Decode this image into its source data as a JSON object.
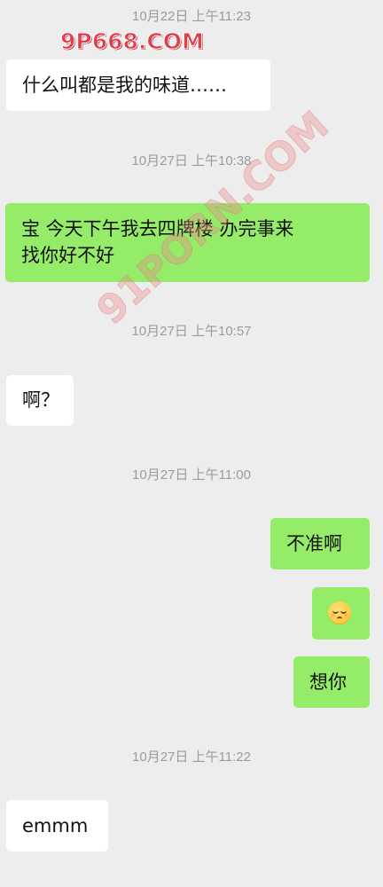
{
  "messages": [
    {
      "timestamp": "10月22日 上午11:23",
      "direction": "in",
      "text": "什么叫都是我的味道……"
    },
    {
      "timestamp": "10月27日 上午10:38",
      "direction": "out",
      "line1": "宝 今天下午我去四牌楼 办完事来",
      "line2": "找你好不好"
    },
    {
      "timestamp": "10月27日 上午10:57",
      "direction": "in",
      "text": "啊？"
    },
    {
      "timestamp": "10月27日 上午11:00",
      "direction": "out",
      "text": "不准啊",
      "emoji": "relieved-face-emoji",
      "text2": "想你"
    },
    {
      "timestamp": "10月27日 上午11:22",
      "direction": "in",
      "text": "emmm"
    }
  ],
  "watermarks": {
    "primary": "9P668.COM",
    "diagonal": "91PORN.COM"
  },
  "colors": {
    "background": "#ededed",
    "incoming_bubble": "#ffffff",
    "outgoing_bubble": "#95ec69",
    "timestamp_text": "#9b9b9b",
    "watermark_red": "#e23d4a"
  }
}
